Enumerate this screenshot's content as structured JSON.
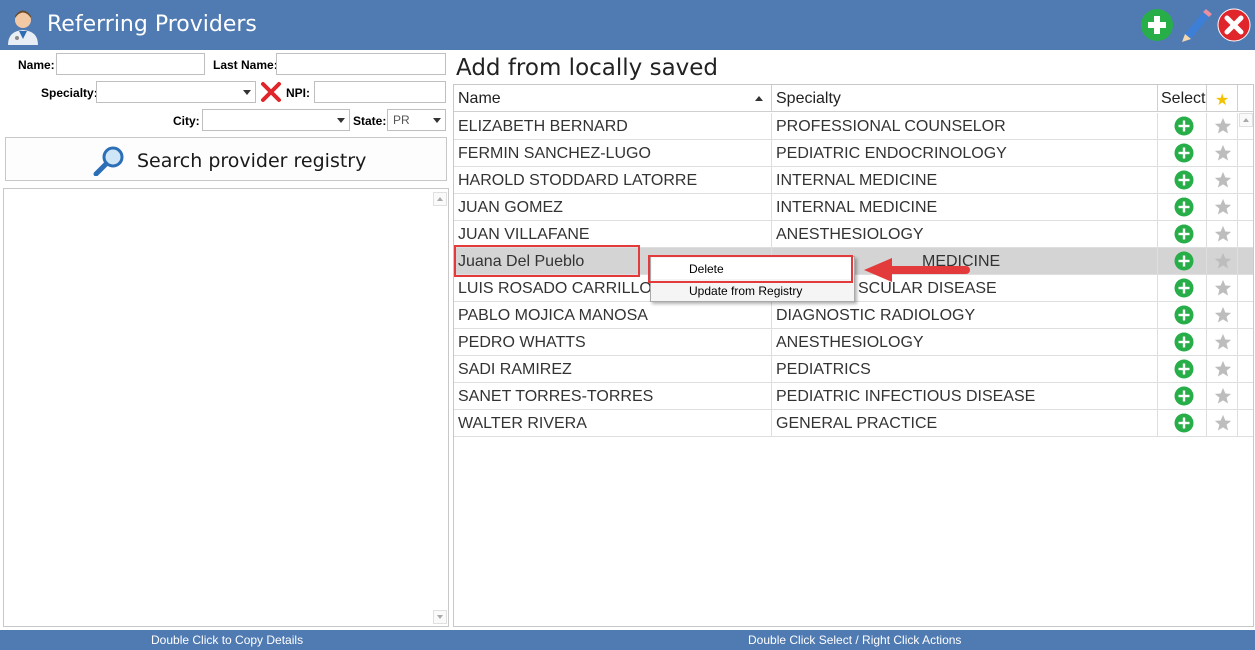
{
  "window": {
    "title": "Referring Providers"
  },
  "search_form": {
    "name_label": "Name:",
    "name_value": "",
    "last_name_label": "Last Name:",
    "last_name_value": "",
    "specialty_label": "Specialty:",
    "specialty_value": "",
    "npi_label": "NPI:",
    "npi_value": "",
    "city_label": "City:",
    "city_value": "",
    "state_label": "State:",
    "state_value": "PR",
    "search_button_label": "Search provider registry"
  },
  "saved_section": {
    "title": "Add from locally saved",
    "columns": {
      "name": "Name",
      "specialty": "Specialty",
      "select": "Select",
      "favorite": "★"
    },
    "rows": [
      {
        "name": "ELIZABETH BERNARD",
        "specialty": "PROFESSIONAL COUNSELOR"
      },
      {
        "name": "FERMIN SANCHEZ-LUGO",
        "specialty": "PEDIATRIC ENDOCRINOLOGY"
      },
      {
        "name": "HAROLD STODDARD LATORRE",
        "specialty": "INTERNAL MEDICINE"
      },
      {
        "name": "JUAN GOMEZ",
        "specialty": "INTERNAL MEDICINE"
      },
      {
        "name": "JUAN VILLAFANE",
        "specialty": "ANESTHESIOLOGY"
      },
      {
        "name": "Juana  Del Pueblo",
        "specialty": "MEDICINE",
        "selected": true
      },
      {
        "name": "LUIS ROSADO CARRILLO",
        "specialty": "SCULAR DISEASE"
      },
      {
        "name": "PABLO MOJICA MANOSA",
        "specialty": "DIAGNOSTIC RADIOLOGY"
      },
      {
        "name": "PEDRO WHATTS",
        "specialty": "ANESTHESIOLOGY"
      },
      {
        "name": "SADI RAMIREZ",
        "specialty": "PEDIATRICS"
      },
      {
        "name": "SANET TORRES-TORRES",
        "specialty": "PEDIATRIC INFECTIOUS DISEASE"
      },
      {
        "name": "WALTER RIVERA",
        "specialty": "GENERAL PRACTICE"
      }
    ]
  },
  "context_menu": {
    "items": [
      "Delete",
      "Update from Registry"
    ],
    "highlighted": "Delete"
  },
  "status_bar": {
    "left": "Double Click to Copy Details",
    "right": "Double Click Select / Right Click Actions"
  },
  "colors": {
    "titlebar": "#4f7ab2",
    "add_green": "#27ae48",
    "delete_red": "#e0252b",
    "star_gold": "#f2c200",
    "star_gray": "#bdbdbd",
    "annotation_red": "#e33b3b",
    "selected_row": "#d4d4d4"
  },
  "icons": {
    "app": "doctor-avatar-icon",
    "add": "plus-circle-icon",
    "edit": "pencil-icon",
    "close": "close-circle-icon",
    "clear": "red-x-icon",
    "search": "magnifier-icon",
    "select": "plus-circle-icon",
    "favorite": "star-icon"
  }
}
